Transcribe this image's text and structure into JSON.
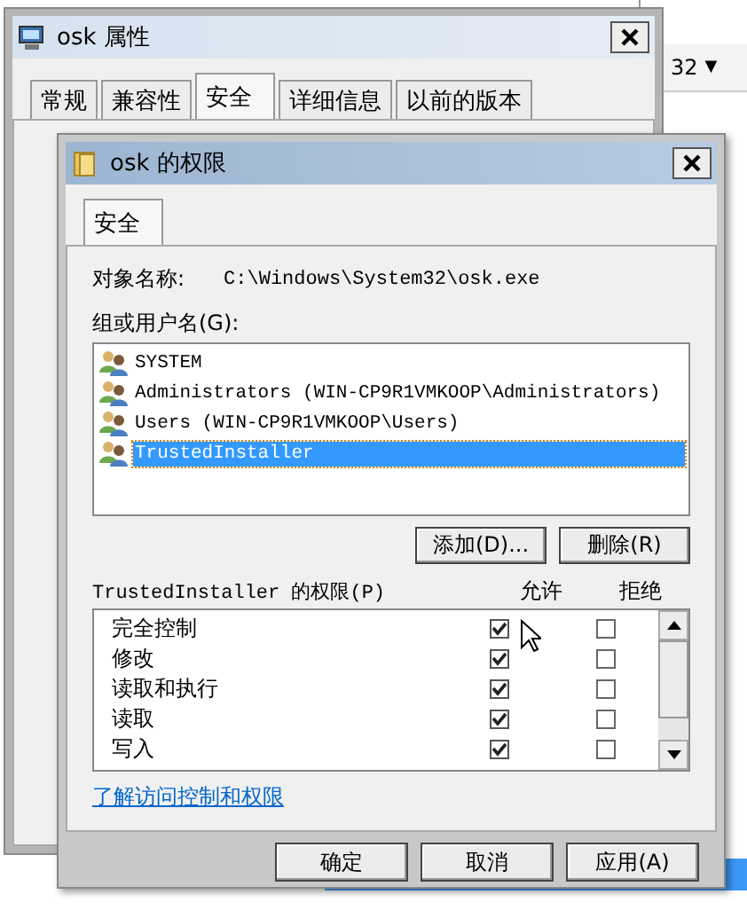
{
  "background_window": {
    "text": "32",
    "dropdown_arrow": "▼"
  },
  "properties_dialog": {
    "title": "osk 属性",
    "tabs": [
      {
        "label": "常规",
        "selected": false
      },
      {
        "label": "兼容性",
        "selected": false
      },
      {
        "label": "安全",
        "selected": true
      },
      {
        "label": "详细信息",
        "selected": false
      },
      {
        "label": "以前的版本",
        "selected": false
      }
    ]
  },
  "permissions_dialog": {
    "title": "osk 的权限",
    "tabs": [
      {
        "label": "安全",
        "selected": true
      }
    ],
    "object_name_label": "对象名称:",
    "object_name": "C:\\Windows\\System32\\osk.exe",
    "groups_label": "组或用户名(G):",
    "users": [
      {
        "name": "SYSTEM",
        "selected": false
      },
      {
        "name": "Administrators (WIN-CP9R1VMKOOP\\Administrators)",
        "selected": false
      },
      {
        "name": "Users (WIN-CP9R1VMKOOP\\Users)",
        "selected": false
      },
      {
        "name": "TrustedInstaller",
        "selected": true
      }
    ],
    "add_button": "添加(D)...",
    "remove_button": "删除(R)",
    "permissions_label": "TrustedInstaller 的权限(P)",
    "allow_header": "允许",
    "deny_header": "拒绝",
    "permissions": [
      {
        "name": "完全控制",
        "allow": true,
        "deny": false
      },
      {
        "name": "修改",
        "allow": true,
        "deny": false
      },
      {
        "name": "读取和执行",
        "allow": true,
        "deny": false
      },
      {
        "name": "读取",
        "allow": true,
        "deny": false
      },
      {
        "name": "写入",
        "allow": true,
        "deny": false
      }
    ],
    "link": "了解访问控制和权限",
    "buttons": [
      "确定",
      "取消",
      "应用(A)"
    ]
  }
}
